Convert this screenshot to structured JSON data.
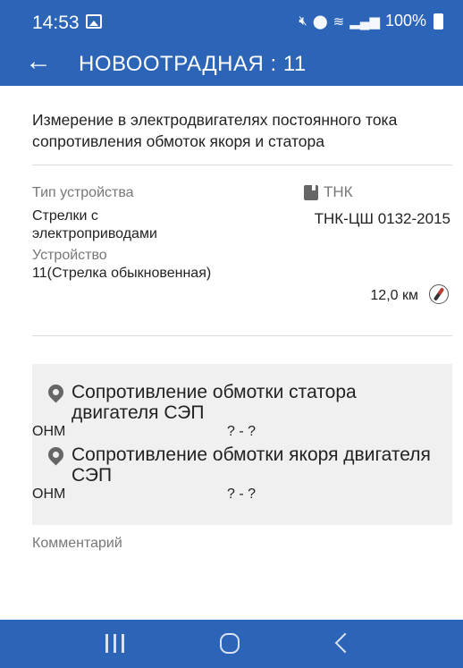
{
  "status_bar": {
    "time": "14:53",
    "battery": "100%",
    "icons": [
      "gallery-icon",
      "mute-icon",
      "location-icon",
      "wifi-call-icon",
      "volte-icon",
      "signal-icon",
      "battery-icon"
    ]
  },
  "app_bar": {
    "title": "НОВООТРАДНАЯ : 11",
    "background": "#2c64b8"
  },
  "work": {
    "heading": "Измерение в электродвигателях постоянного тока сопротивления обмоток якоря и статора",
    "device_type_label": "Тип устройства",
    "device_type_value": "Стрелки с электроприводами",
    "device_label": "Устройство",
    "device_value": "11(Стрелка обыкновенная)",
    "doc_label": "ТНК",
    "doc_code": "ТНК-ЦШ 0132-2015",
    "distance": "12,0 км"
  },
  "params": [
    {
      "name": "Сопротивление обмотки статора двигателя СЭП",
      "unit": "ОНМ",
      "range": "? - ?"
    },
    {
      "name": "Сопротивление обмотки якоря двигателя СЭП",
      "unit": "ОНМ",
      "range": "? - ?"
    }
  ],
  "comment_label": "Комментарий",
  "nav_bar": {
    "background": "#2c64b8"
  }
}
